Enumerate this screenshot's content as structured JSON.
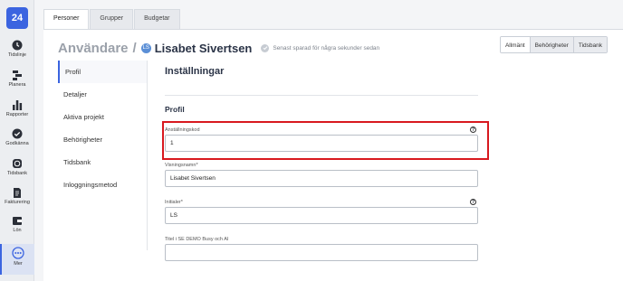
{
  "logo": "24",
  "nav": [
    {
      "label": "Tidslinje",
      "icon": "clock-icon"
    },
    {
      "label": "Planera",
      "icon": "planning-icon"
    },
    {
      "label": "Rapporter",
      "icon": "bar-chart-icon"
    },
    {
      "label": "Godkänna",
      "icon": "check-circle-icon"
    },
    {
      "label": "Tidsbank",
      "icon": "timebank-icon"
    },
    {
      "label": "Fakturering",
      "icon": "invoice-icon"
    },
    {
      "label": "Lön",
      "icon": "wallet-icon"
    },
    {
      "label": "Mer",
      "icon": "more-icon"
    }
  ],
  "toptabs": [
    "Personer",
    "Grupper",
    "Budgetar"
  ],
  "header": {
    "crumb": "Användare",
    "slash": "/",
    "avatar_initials": "LS",
    "name": "Lisabet Sivertsen",
    "saved": "Senast sparad för några sekunder sedan"
  },
  "rtabs": [
    "Allmänt",
    "Behörigheter",
    "Tidsbank"
  ],
  "sidemenu": [
    "Profil",
    "Detaljer",
    "Aktiva projekt",
    "Behörigheter",
    "Tidsbank",
    "Inloggningsmetod"
  ],
  "content": {
    "title": "Inställningar",
    "section": "Profil"
  },
  "fields": [
    {
      "label": "Anställningskod",
      "value": "1",
      "help": "?"
    },
    {
      "label": "Visningsnamn*",
      "value": "Lisabet Sivertsen",
      "help": ""
    },
    {
      "label": "Initialer*",
      "value": "LS",
      "help": "?"
    },
    {
      "label": "Titel i SE DEMO Busy och AI",
      "value": "",
      "help": ""
    }
  ],
  "colors": {
    "accent": "#3b64e0",
    "highlight": "#d8191f"
  }
}
